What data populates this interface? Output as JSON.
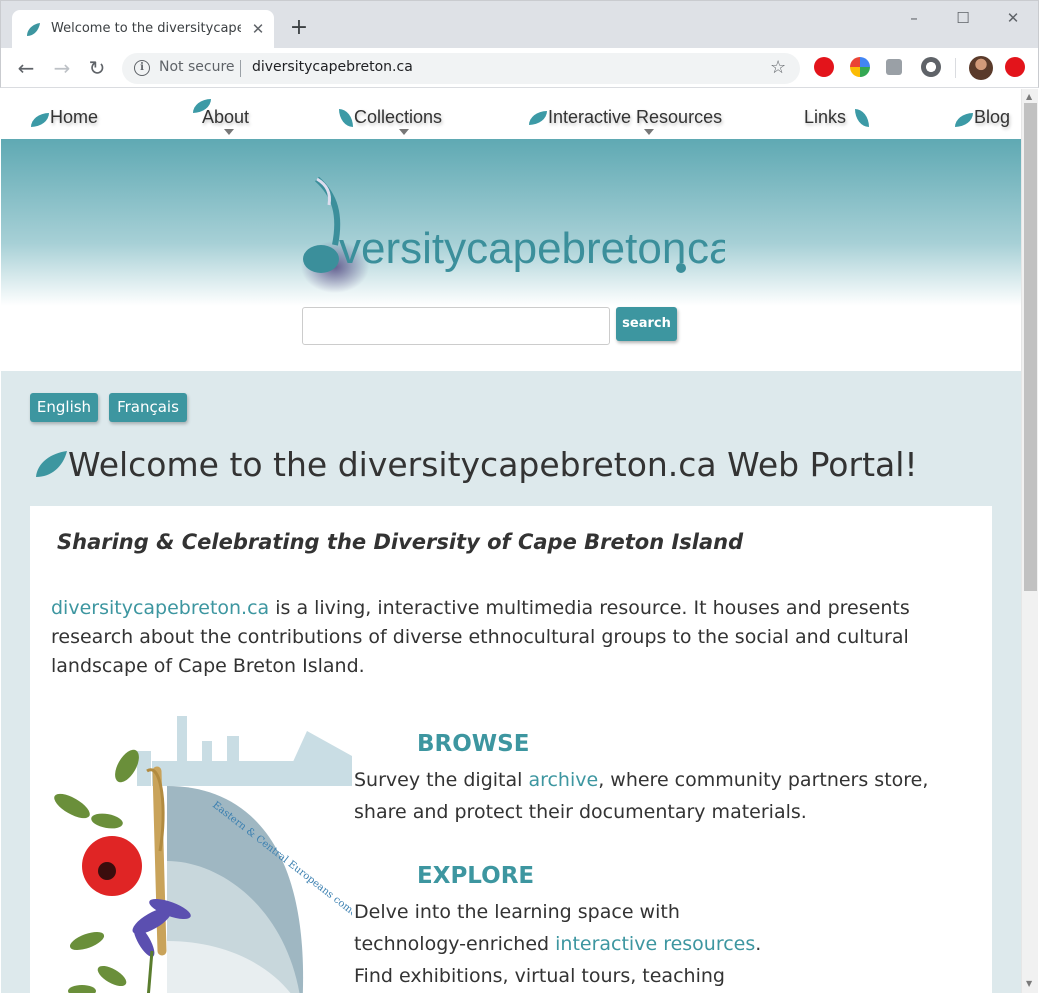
{
  "browser": {
    "tab_title": "Welcome to the diversitycapebreton.ca Web Portal!",
    "new_tab": "+",
    "window_controls": {
      "minimize": "–",
      "maximize": "☐",
      "close": "✕"
    },
    "nav": {
      "back": "←",
      "forward": "→",
      "reload": "↻"
    },
    "security_label": "Not secure",
    "url": "diversitycapebreton.ca",
    "star": "☆"
  },
  "site_nav": {
    "items": [
      {
        "label": "Home"
      },
      {
        "label": "About"
      },
      {
        "label": "Collections"
      },
      {
        "label": "Interactive Resources"
      },
      {
        "label": "Links"
      },
      {
        "label": "Blog"
      }
    ]
  },
  "header": {
    "logo_text": "versitycapebreton",
    "logo_tld": "ca",
    "search_value": "",
    "search_button": "search"
  },
  "language": {
    "english": "English",
    "french": "Français"
  },
  "main": {
    "heading": "Welcome to the diversitycapebreton.ca Web Portal!",
    "tagline": "Sharing & Celebrating the Diversity of Cape Breton Island",
    "intro_link": "diversitycapebreton.ca",
    "intro_text": " is a living, interactive multimedia resource. It houses and presents research about the contributions of diverse ethnocultural groups to the social and cultural landscape of Cape Breton Island.",
    "art_caption": "Eastern & Central Europeans come ashore",
    "browse": {
      "title": "BROWSE",
      "text_before": "Survey the digital ",
      "link": "archive",
      "text_after": ", where community partners store, share and protect their documentary materials."
    },
    "explore": {
      "title": "EXPLORE",
      "text_before": "Delve into the learning space with technology-enriched ",
      "link": "interactive resources",
      "text_after": ". Find exhibitions, virtual tours, teaching materials and more!"
    }
  },
  "colors": {
    "accent": "#3d96a0",
    "page_bg": "#dde9ec",
    "header_top": "#5fa9b3"
  },
  "icons": [
    "leaf-favicon-icon",
    "info-icon",
    "star-icon",
    "adblock-icon",
    "extension-icon",
    "avatar",
    "leaf-bullet-icon",
    "music-note-logo-icon",
    "dropdown-caret-icon"
  ]
}
